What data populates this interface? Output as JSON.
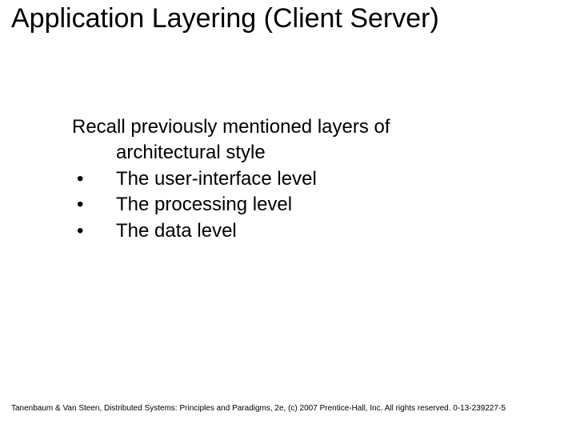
{
  "title": "Application Layering (Client Server)",
  "intro_line1": "Recall previously mentioned layers of",
  "intro_line2": "architectural style",
  "bullets": [
    {
      "marker": "•",
      "text": "The user-interface level"
    },
    {
      "marker": "•",
      "text": "The processing level"
    },
    {
      "marker": "•",
      "text": "The data level"
    }
  ],
  "footer": "Tanenbaum & Van Steen, Distributed Systems: Principles and Paradigms, 2e, (c) 2007 Prentice-Hall, Inc. All rights reserved. 0-13-239227-5"
}
